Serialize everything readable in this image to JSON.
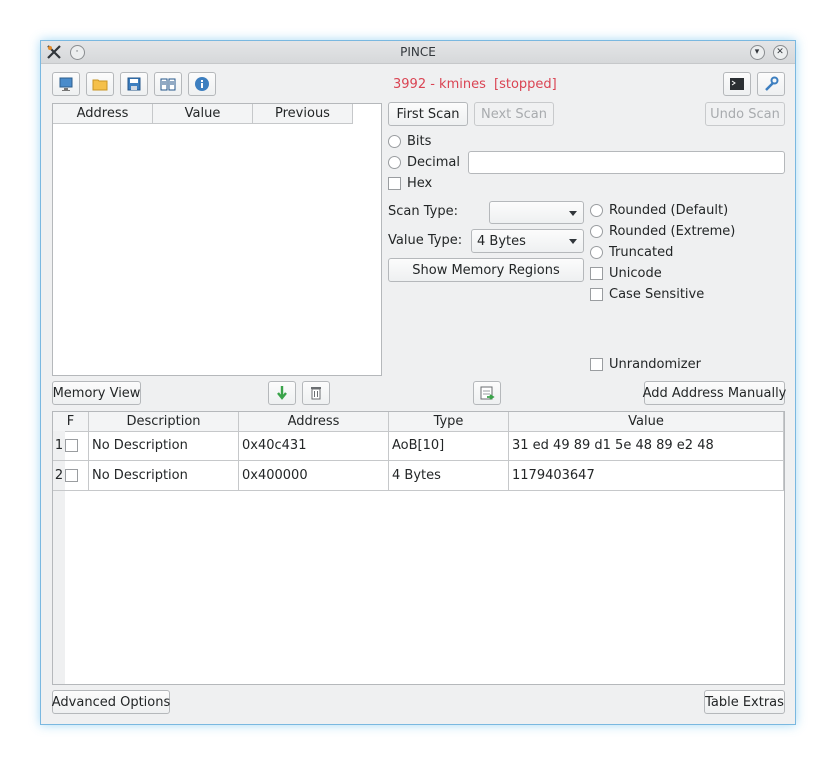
{
  "window": {
    "title": "PINCE"
  },
  "status": {
    "process": "3992 - kmines",
    "state": "[stopped]"
  },
  "toolbar": {
    "icons": [
      "attach-process-icon",
      "open-file-icon",
      "save-file-icon",
      "wiki-icon",
      "about-icon"
    ],
    "right_icons": [
      "console-icon",
      "settings-icon"
    ]
  },
  "scan_results": {
    "columns": [
      "Address",
      "Value",
      "Previous"
    ]
  },
  "scan_buttons": {
    "first": "First Scan",
    "next": "Next Scan",
    "undo": "Undo Scan"
  },
  "radix": {
    "bits": "Bits",
    "decimal": "Decimal",
    "hex": "Hex"
  },
  "search": {
    "value": ""
  },
  "scan_type": {
    "label": "Scan Type:",
    "value": ""
  },
  "value_type": {
    "label": "Value Type:",
    "value": "4 Bytes"
  },
  "memory_regions_button": "Show Memory Regions",
  "options": {
    "rounded_default": "Rounded (Default)",
    "rounded_extreme": "Rounded (Extreme)",
    "truncated": "Truncated",
    "unicode": "Unicode",
    "case_sensitive": "Case Sensitive",
    "unrandomizer": "Unrandomizer"
  },
  "memory_view_button": "Memory View",
  "add_manual_button": "Add Address Manually",
  "address_table": {
    "columns": [
      "F",
      "Description",
      "Address",
      "Type",
      "Value"
    ],
    "rows": [
      {
        "num": "1",
        "description": "No Description",
        "address": "0x40c431",
        "type": "AoB[10]",
        "value": "31 ed 49 89 d1 5e 48 89 e2 48"
      },
      {
        "num": "2",
        "description": "No Description",
        "address": "0x400000",
        "type": "4 Bytes",
        "value": "1179403647"
      }
    ]
  },
  "advanced_button": "Advanced Options",
  "table_extras_button": "Table Extras"
}
